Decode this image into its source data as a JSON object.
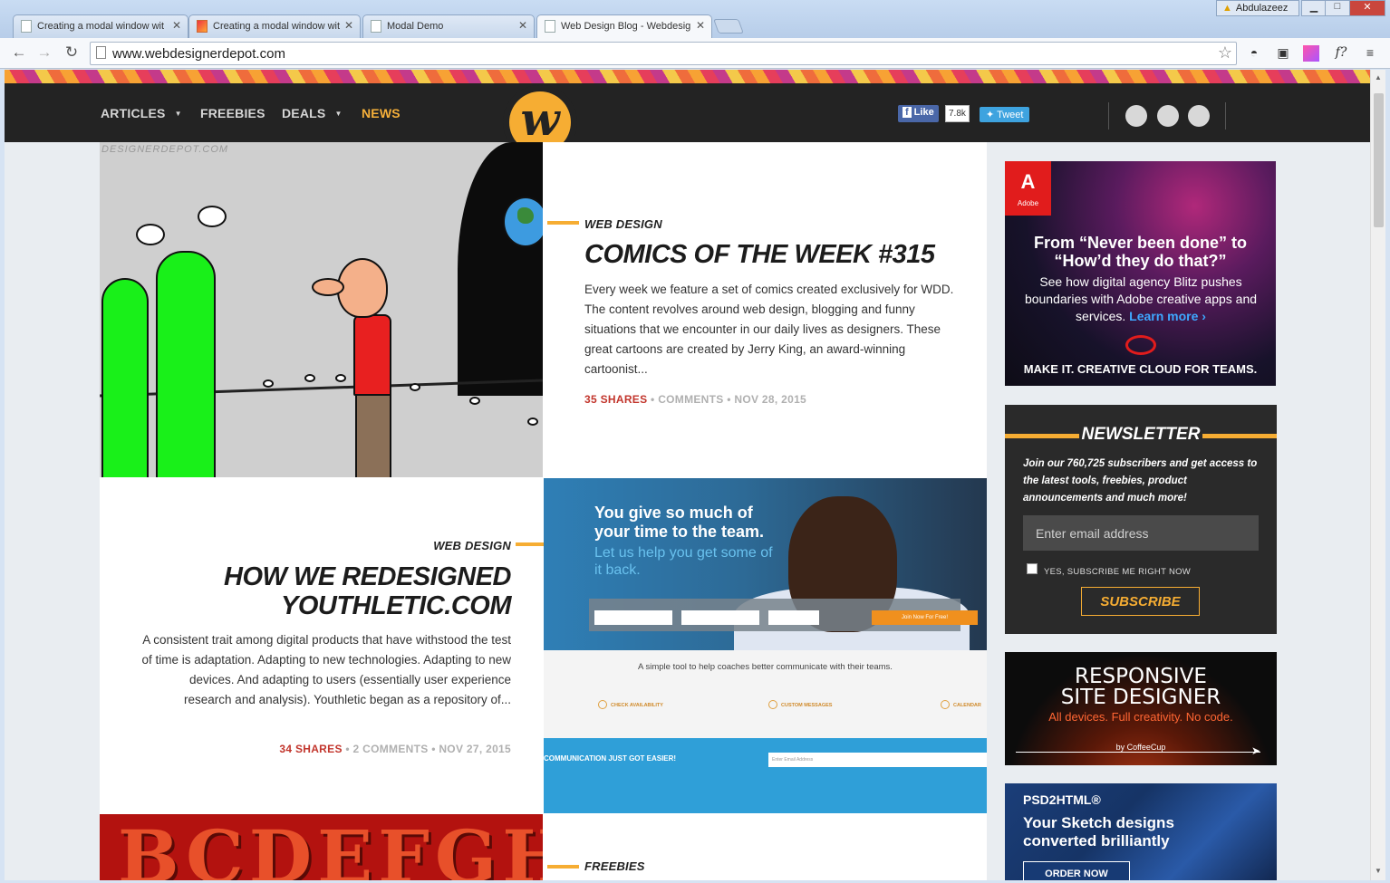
{
  "browser": {
    "tabs": [
      {
        "title": "Creating a modal window wit"
      },
      {
        "title": "Creating a modal window wit"
      },
      {
        "title": "Modal Demo"
      },
      {
        "title": "Web Design Blog - Webdesig"
      }
    ],
    "user_name": "Abdulazeez",
    "window_buttons": {
      "minimize": "▁",
      "maximize": "□",
      "close": "✕"
    },
    "url": "www.webdesignerdepot.com"
  },
  "site": {
    "nav": {
      "articles": "ARTICLES",
      "freebies": "FREEBIES",
      "deals": "DEALS",
      "news": "NEWS"
    },
    "logo_letter": "w",
    "social": {
      "fb_like": "Like",
      "fb_count": "7.8k",
      "tweet": "Tweet"
    }
  },
  "posts": [
    {
      "category": "WEB DESIGN",
      "title": "COMICS OF THE WEEK #315",
      "excerpt": "Every week we feature a set of comics created exclusively for WDD. The content revolves around web design, blogging and funny situations that we encounter in our daily lives as designers. These great cartoons are created by Jerry King, an award-winning cartoonist...",
      "shares": "35 SHARES",
      "comments": "COMMENTS",
      "date": "NOV 28, 2015",
      "image_watermark": "DESIGNERDEPOT.COM"
    },
    {
      "category": "WEB DESIGN",
      "title_line1": "HOW WE REDESIGNED",
      "title_line2": "YOUTHLETIC.COM",
      "excerpt": "A consistent trait among digital products that have withstood the test of time is adaptation. Adapting to new technologies. Adapting to new devices. And adapting to users (essentially user experience research and analysis). Youthletic began as a repository of...",
      "shares": "34 SHARES",
      "comments": "2 COMMENTS",
      "date": "NOV 27, 2015",
      "shot": {
        "headline1": "You give so much of",
        "headline2": "your time to the team.",
        "sub1": "Let us help you get some of",
        "sub2": "it back.",
        "form_button": "Join Now For Free!",
        "caption": "A simple tool to help coaches better communicate with their teams.",
        "features": [
          "CHECK AVAILABILITY",
          "CUSTOM MESSAGES",
          "CALENDAR"
        ],
        "cta": "COMMUNICATION JUST GOT EASIER!",
        "email_placeholder": "Enter Email Address"
      }
    },
    {
      "category": "FREEBIES",
      "image_text": "BCDEFGHI"
    }
  ],
  "sidebar": {
    "adobe": {
      "logo": "A",
      "logo_text": "Adobe",
      "headline1": "From “Never been done” to",
      "headline2": "“How’d they do that?”",
      "body": "See how digital agency Blitz pushes boundaries with Adobe creative apps and services.",
      "learn_more": "Learn more ›",
      "footer": "MAKE IT. CREATIVE CLOUD FOR TEAMS."
    },
    "newsletter": {
      "title": "NEWSLETTER",
      "text": "Join our 760,725 subscribers and get access to the latest tools, freebies, product announcements and much more!",
      "email_placeholder": "Enter email address",
      "checkbox_label": "YES, SUBSCRIBE ME RIGHT NOW",
      "button": "SUBSCRIBE"
    },
    "rsd": {
      "line1": "RESPONSIVE",
      "line2": "SITE DESIGNER",
      "tagline": "All devices. Full creativity. No code.",
      "by": "by CoffeeCup"
    },
    "psd": {
      "brand": "PSD2HTML®",
      "line1": "Your Sketch designs",
      "line2": "converted brilliantly",
      "button": "ORDER NOW"
    }
  }
}
